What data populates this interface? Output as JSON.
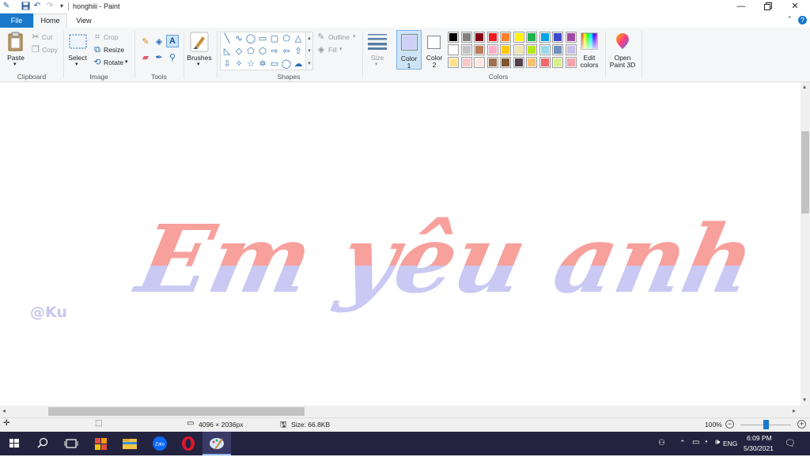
{
  "window": {
    "title": "honghiii - Paint"
  },
  "menu": {
    "file": "File",
    "home": "Home",
    "view": "View"
  },
  "ribbon": {
    "clipboard": {
      "paste": "Paste",
      "cut": "Cut",
      "copy": "Copy",
      "label": "Clipboard"
    },
    "image": {
      "select": "Select",
      "crop": "Crop",
      "resize": "Resize",
      "rotate": "Rotate",
      "label": "Image"
    },
    "tools": {
      "label": "Tools"
    },
    "brushes": {
      "label": "Brushes"
    },
    "shapes": {
      "outline": "Outline",
      "fill": "Fill",
      "label": "Shapes"
    },
    "size": {
      "label": "Size"
    },
    "colors": {
      "color1": "Color",
      "color1_num": "1",
      "color2": "Color",
      "color2_num": "2",
      "edit_colors_1": "Edit",
      "edit_colors_2": "colors",
      "label": "Colors",
      "color1_value": "#cfd0f5",
      "color2_value": "#ffffff",
      "palette": [
        [
          "#000000",
          "#7f7f7f",
          "#880015",
          "#ed1c24",
          "#ff7f27",
          "#fff200",
          "#22b14c",
          "#00a2e8",
          "#3f48cc",
          "#a349a4"
        ],
        [
          "#ffffff",
          "#c3c3c3",
          "#b97a57",
          "#ffaec9",
          "#ffc90e",
          "#efe4b0",
          "#b5e61d",
          "#99d9ea",
          "#7092be",
          "#c8bfe7"
        ],
        [
          "#ffe38f",
          "#f7c8c8",
          "#ffe8e6",
          "#a0704f",
          "#80552e",
          "#523f4e",
          "#f8c171",
          "#f06a6a",
          "#d9f08a",
          "#f3a4a8"
        ]
      ]
    },
    "paint3d": {
      "line1": "Open",
      "line2": "Paint 3D"
    }
  },
  "canvas": {
    "headline": "Em yêu anh",
    "signature": "@Ku",
    "top_color": "#f7a09c",
    "bottom_color": "#c9c9f3"
  },
  "status": {
    "dimensions": "4096 × 2036px",
    "size": "Size: 66.8KB",
    "zoom": "100%"
  },
  "taskbar": {
    "language": "ENG",
    "time": "6:09 PM",
    "date": "5/30/2021"
  }
}
